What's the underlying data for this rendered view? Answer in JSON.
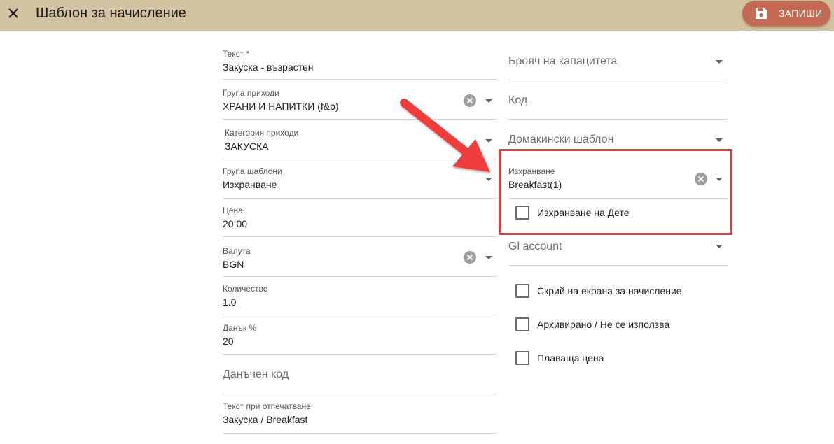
{
  "header": {
    "title": "Шаблон за начисление",
    "save_label": "ЗАПИШИ"
  },
  "left_fields": {
    "text": {
      "label": "Текст *",
      "value": "Закуска - възрастен"
    },
    "revenue_group": {
      "label": "Група приходи",
      "value": "ХРАНИ И НАПИТКИ (f&b)"
    },
    "revenue_category": {
      "label": "Категория приходи",
      "value": "ЗАКУСКА"
    },
    "template_group": {
      "label": "Група шаблони",
      "value": "Изхранване"
    },
    "price": {
      "label": "Цена",
      "value": "20,00"
    },
    "currency": {
      "label": "Валута",
      "value": "BGN"
    },
    "quantity": {
      "label": "Количество",
      "value": "1.0"
    },
    "tax": {
      "label": "Данък %",
      "value": "20"
    },
    "tax_code": {
      "placeholder": "Данъчен код"
    },
    "print_text": {
      "label": "Текст при отпечатване",
      "value": "Закуска / Breakfast"
    }
  },
  "right_fields": {
    "capacity_counter": {
      "placeholder": "Брояч на капацитета"
    },
    "code": {
      "placeholder": "Код"
    },
    "housekeeping_template": {
      "placeholder": "Домакински шаблон"
    },
    "meal_plan": {
      "label": "Изхранване",
      "value": "Breakfast(1)"
    },
    "gl_account": {
      "placeholder": "Gl account"
    }
  },
  "checkboxes": {
    "child_meal": {
      "label": "Изхранване на Дете",
      "checked": false
    },
    "hide_on_charge_screen": {
      "label": "Скрий на екрана за начисление",
      "checked": false
    },
    "archived": {
      "label": "Архивирано / Не се използва",
      "checked": false
    },
    "floating_price": {
      "label": "Плаваща цена",
      "checked": false
    }
  },
  "colors": {
    "topbar": "#d2c29f",
    "save_button": "#c56a52",
    "annotation_red": "#e5393b"
  },
  "icons": {
    "close": "close-icon",
    "save": "floppy-disk-icon",
    "clear": "clear-circle-icon",
    "dropdown": "chevron-down-icon"
  }
}
